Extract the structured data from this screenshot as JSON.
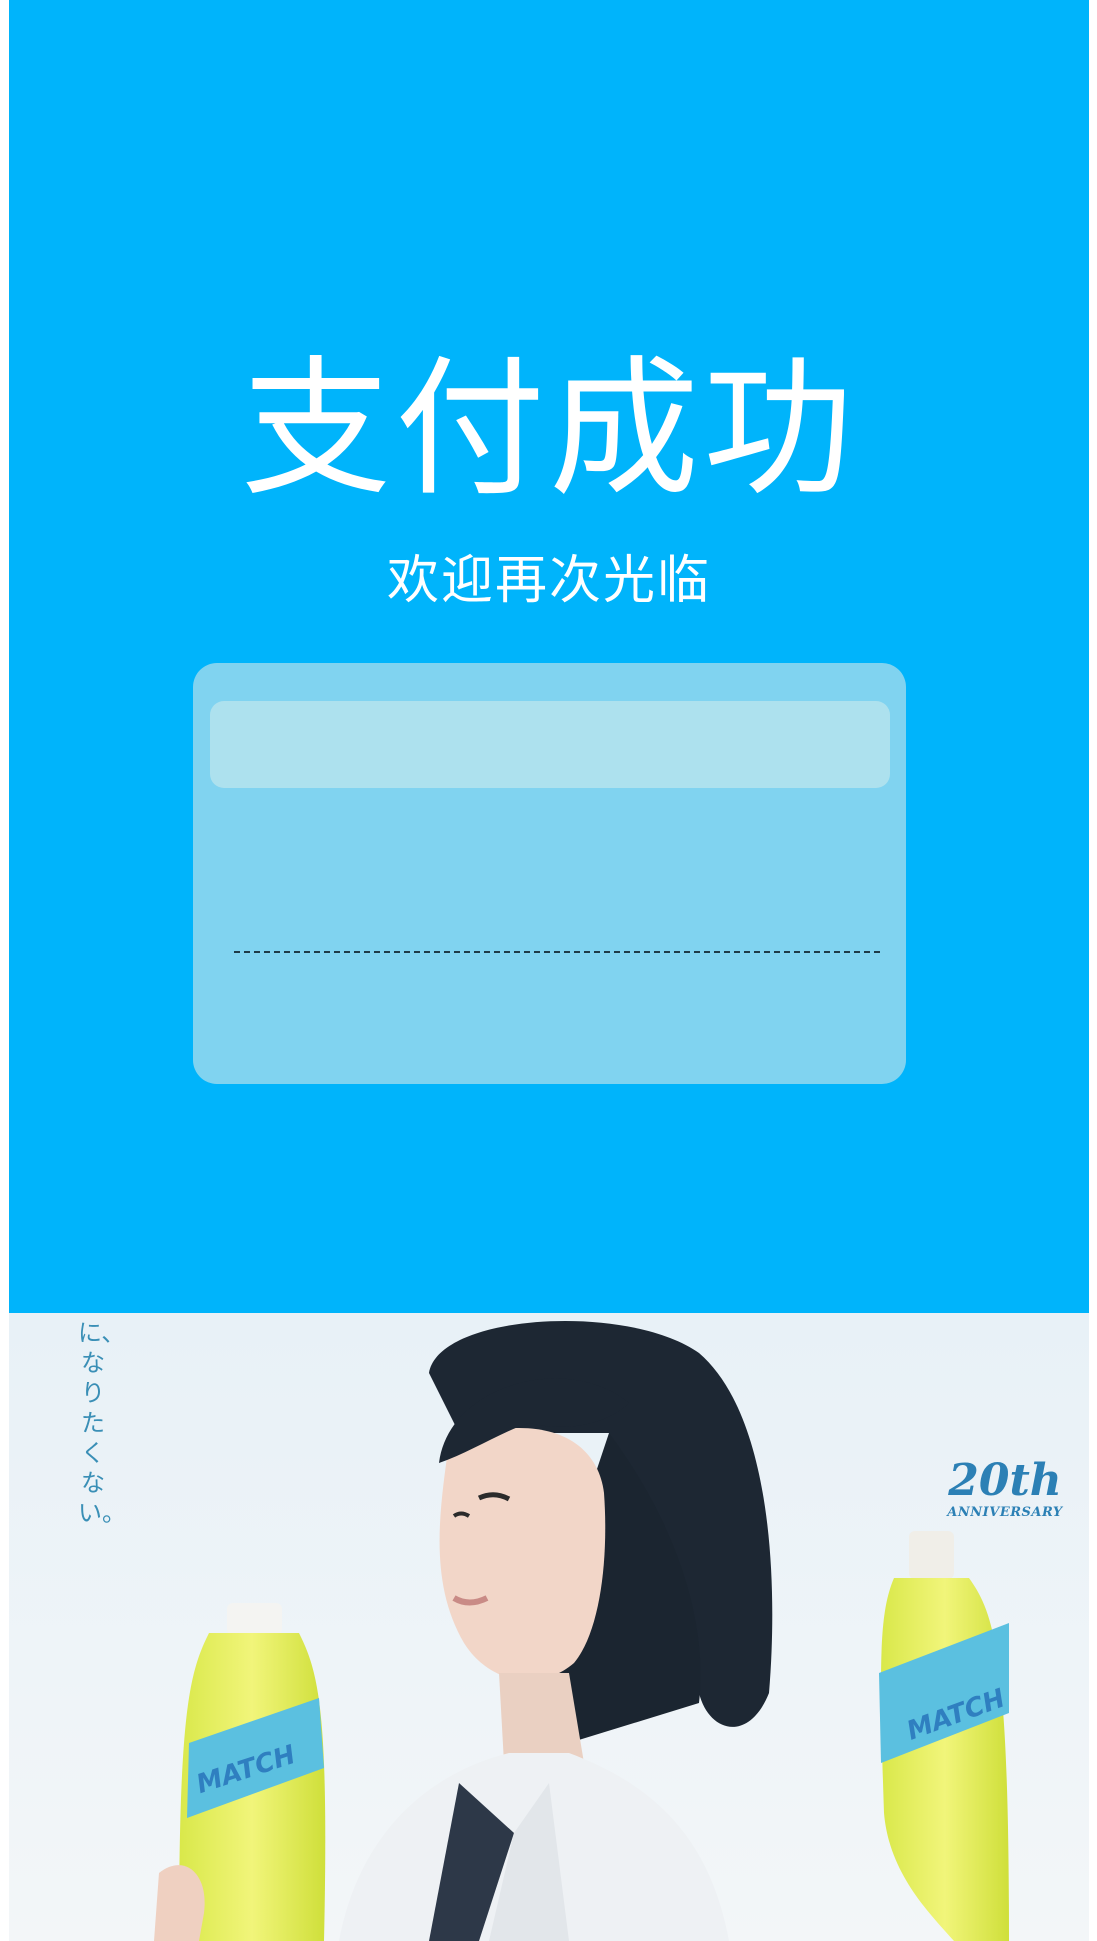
{
  "payment": {
    "title": "支付成功",
    "subtitle": "欢迎再次光临"
  },
  "colors": {
    "panel_background": "#00b4fb",
    "card_background": "#80d3f0",
    "card_header": "#ade1ee",
    "text": "#ffffff"
  },
  "advertisement": {
    "vertical_text": "に、なりたくない。",
    "anniversary_number": "20th",
    "anniversary_word": "ANNIVERSARY",
    "product_name": "MATCH"
  }
}
